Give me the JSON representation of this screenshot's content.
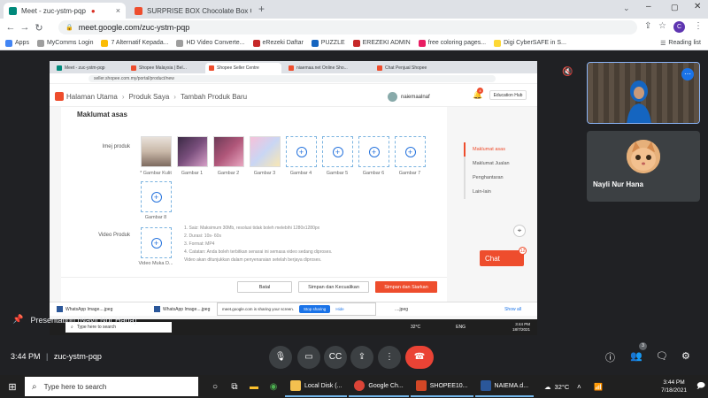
{
  "chrome": {
    "tabs": [
      {
        "label": "Meet - zuc-ystm-pqp",
        "color": "#00897b"
      },
      {
        "label": "SURPRISE BOX Chocolate Box Gi",
        "color": "#ee4d2d"
      }
    ],
    "url": "meet.google.com/zuc-ystm-pqp",
    "bookmarks": [
      {
        "label": "Apps",
        "color": "#4285f4"
      },
      {
        "label": "MyComms Login",
        "color": "#9e9e9e"
      },
      {
        "label": "7 Alternatif Kepada...",
        "color": "#fbbc04"
      },
      {
        "label": "HD Video Converte...",
        "color": "#9e9e9e"
      },
      {
        "label": "eRezeki Daftar",
        "color": "#c62828"
      },
      {
        "label": "PUZZLE",
        "color": "#1565c0"
      },
      {
        "label": "EREZEKI ADMIN",
        "color": "#c62828"
      },
      {
        "label": "free coloring pages...",
        "color": "#e91e63"
      },
      {
        "label": "Digi CyberSAFE in S...",
        "color": "#fdd835"
      }
    ],
    "reading_list": "Reading list"
  },
  "shared": {
    "tabs": [
      "Meet - zuc-ystm-pqp",
      "Shopee Malaysia | Bel...",
      "Shopee Seller Centre",
      "niaemaa.net Online Sho...",
      "Chat Penjual Shopee"
    ],
    "url": "seller.shopee.com.my/portal/product/new",
    "breadcrumb": [
      "Halaman Utama",
      "Produk Saya",
      "Tambah Produk Baru"
    ],
    "username": "naiemaalnaf",
    "bell_count": "4",
    "education_hub": "Education Hub",
    "section_title": "Maklumat asas",
    "image_label": "Imej produk",
    "video_label": "Video Produk",
    "slots": [
      {
        "caption": "* Gambar Kulit",
        "filled": true,
        "color": "#c9b8a8"
      },
      {
        "caption": "Gambar 1",
        "filled": true,
        "color": "#7a4f7d"
      },
      {
        "caption": "Gambar 2",
        "filled": true,
        "color": "#b0577a"
      },
      {
        "caption": "Gambar 3",
        "filled": true,
        "color": "#e7c3dc"
      },
      {
        "caption": "Gambar 4",
        "filled": false
      },
      {
        "caption": "Gambar 5",
        "filled": false
      },
      {
        "caption": "Gambar 6",
        "filled": false
      },
      {
        "caption": "Gambar 7",
        "filled": false
      },
      {
        "caption": "Gambar 8",
        "filled": false
      }
    ],
    "video_caption": "Video Muka D...",
    "notes": [
      "1. Saiz: Maksimum 30Mb, resolusi tidak boleh melebihi 1280x1280px",
      "2. Durasi: 10s- 60s",
      "3. Format: MP4",
      "4. Catatan: Anda boleh terbitkan senarai ini semasa video sedang diproses.",
      "Video akan ditunjukkan dalam penyenaraian setelah berjaya diproses."
    ],
    "buttons": {
      "cancel": "Batal",
      "save_hide": "Simpan dan Kecualikan",
      "save_show": "Simpan dan Siarkan"
    },
    "side_menu": [
      "Maklumat asas",
      "Maklumat Jualan",
      "Penghantaran",
      "Lain-lain"
    ],
    "chat": {
      "label": "Chat",
      "badge": "12"
    },
    "downloads": [
      "WhatsApp Image....jpeg",
      "WhatsApp Image....jpeg",
      "....jpeg"
    ],
    "share_text": "meet.google.com is sharing your screen.",
    "stop_sharing": "Stop sharing",
    "hide": "Hide",
    "show_all": "Show all",
    "taskbar_search": "Type here to search",
    "temp": "32°C",
    "lang": "ENG",
    "time": "3:44 PM",
    "date": "18/7/2021"
  },
  "meet": {
    "presenter": "Presentation (Nayli Nur Hana)",
    "participant2": "Nayli Nur Hana",
    "time": "3:44 PM",
    "code": "zuc-ystm-pqp",
    "people_count": "3"
  },
  "windows": {
    "search": "Type here to search",
    "apps": [
      {
        "label": "Local Disk (...",
        "color": "#f4c04f"
      },
      {
        "label": "Google Ch...",
        "color": "#db4437"
      },
      {
        "label": "SHOPEE10...",
        "color": "#d24726"
      },
      {
        "label": "NAIEMA.d...",
        "color": "#2b579a"
      }
    ],
    "temp": "32°C",
    "time": "3:44 PM",
    "date": "7/18/2021"
  }
}
